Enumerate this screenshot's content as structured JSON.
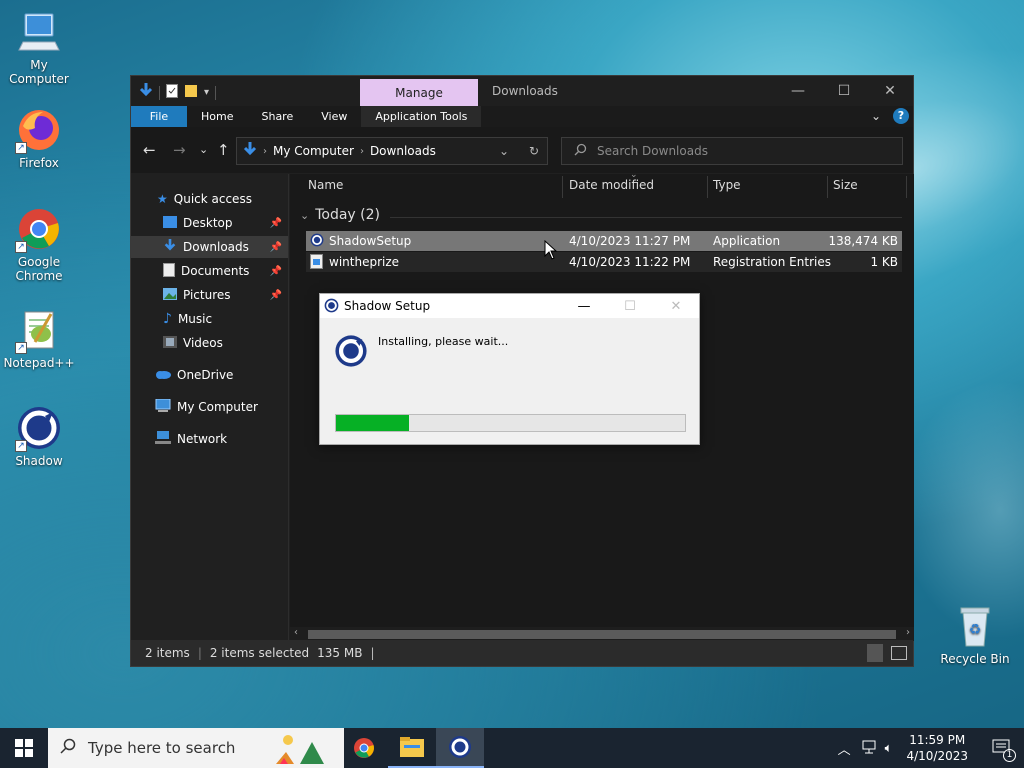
{
  "desktop": {
    "icons": [
      {
        "label": "My Computer"
      },
      {
        "label": "Firefox"
      },
      {
        "label": "Google Chrome"
      },
      {
        "label": "Notepad++"
      },
      {
        "label": "Shadow"
      },
      {
        "label": "Recycle Bin"
      }
    ]
  },
  "explorer": {
    "manage_tab": "Manage",
    "window_title": "Downloads",
    "ribbon": {
      "file": "File",
      "home": "Home",
      "share": "Share",
      "view": "View",
      "app_tools": "Application Tools",
      "help": "?"
    },
    "address": {
      "crumb1": "My Computer",
      "crumb2": "Downloads"
    },
    "search_placeholder": "Search Downloads",
    "nav": {
      "quick_access": "Quick access",
      "desktop": "Desktop",
      "downloads": "Downloads",
      "documents": "Documents",
      "pictures": "Pictures",
      "music": "Music",
      "videos": "Videos",
      "onedrive": "OneDrive",
      "my_computer": "My Computer",
      "network": "Network"
    },
    "columns": {
      "name": "Name",
      "date": "Date modified",
      "type": "Type",
      "size": "Size"
    },
    "group": "Today (2)",
    "files": [
      {
        "name": "ShadowSetup",
        "date": "4/10/2023 11:27 PM",
        "type": "Application",
        "size": "138,474 KB"
      },
      {
        "name": "wintheprize",
        "date": "4/10/2023 11:22 PM",
        "type": "Registration Entries",
        "size": "1 KB"
      }
    ],
    "status": {
      "items": "2 items",
      "selected": "2 items selected",
      "size": "135 MB"
    }
  },
  "dialog": {
    "title": "Shadow Setup",
    "message": "Installing, please wait...",
    "progress_fraction": 0.21
  },
  "taskbar": {
    "search_placeholder": "Type here to search",
    "time": "11:59 PM",
    "date": "4/10/2023",
    "notification_count": "1"
  },
  "colors": {
    "accent": "#1f7bbd",
    "manage_tab": "#e4c5f1",
    "progress": "#06b025"
  }
}
